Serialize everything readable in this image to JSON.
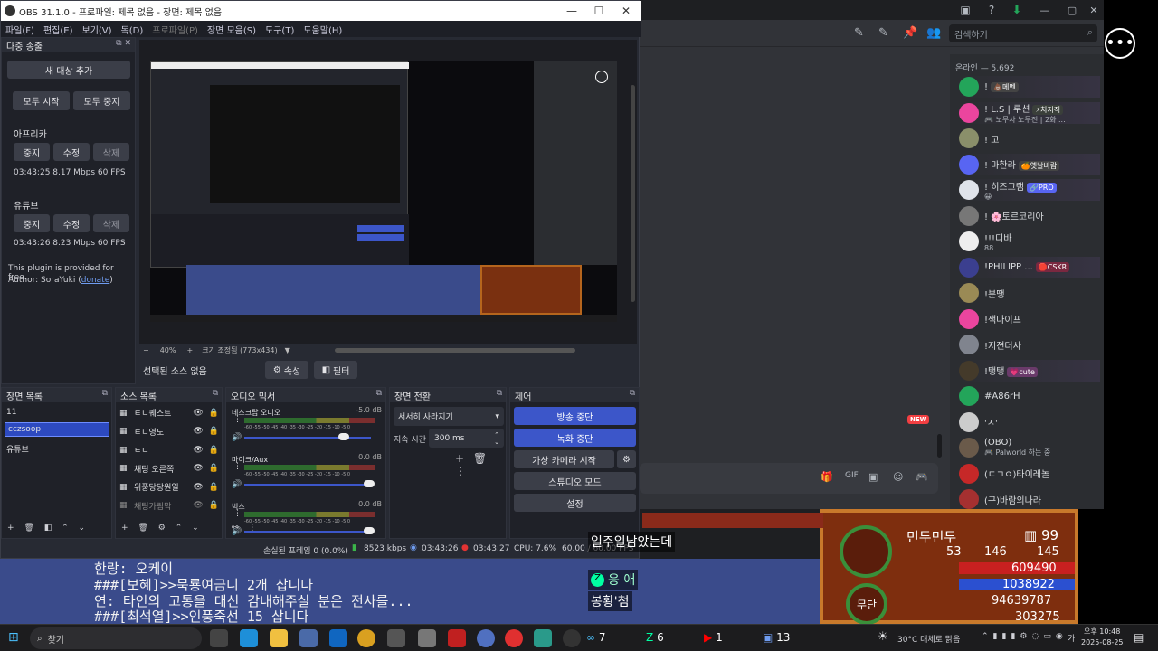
{
  "obs": {
    "title": "OBS 31.1.0 - 프로파일: 제목 없음 - 장면: 제목 없음",
    "menu": [
      "파일(F)",
      "편집(E)",
      "보기(V)",
      "독(D)",
      "프로파일(P)",
      "장면 모음(S)",
      "도구(T)",
      "도움말(H)"
    ],
    "multistream": {
      "title": "다중 송출",
      "add_target": "새 대상 추가",
      "start_all": "모두 시작",
      "stop_all": "모두 중지",
      "targets": [
        {
          "name": "아프리카",
          "stop": "중지",
          "edit": "수정",
          "delete": "삭제",
          "stats": "03:43:25  8.17 Mbps  60 FPS"
        },
        {
          "name": "유튜브",
          "stop": "중지",
          "edit": "수정",
          "delete": "삭제",
          "stats": "03:43:26  8.23 Mbps  60 FPS"
        }
      ],
      "plugin_note": "This plugin is provided for free.",
      "author_prefix": "Author: SoraYuki (",
      "author_link": "donate",
      "author_suffix": ")"
    },
    "zoom": "40%",
    "zoom_mode": "크기 조정됨 (773x434)",
    "no_source": "선택된 소스 없음",
    "properties": "속성",
    "filters": "필터",
    "scenes": {
      "title": "장면 목록",
      "items": [
        "11",
        "cczsoop",
        "유튜브"
      ]
    },
    "sources": {
      "title": "소스 목록",
      "items": [
        "ㅌㄴ퀘스트",
        "ㅌㄴ영도",
        "ㅌㄴ",
        "채팅 오른쪽",
        "위풍당당원일",
        "채팅가림막"
      ]
    },
    "mixer": {
      "title": "오디오 믹서",
      "channels": [
        {
          "name": "데스크탑 오디오",
          "db": "-5.0 dB"
        },
        {
          "name": "마이크/Aux",
          "db": "0.0 dB"
        },
        {
          "name": "빅스",
          "db": "0.0 dB"
        }
      ],
      "scale": "-60 -55 -50 -45 -40 -35 -30 -25 -20 -15 -10 -5 0"
    },
    "transitions": {
      "title": "장면 전환",
      "type": "서서히 사라지기",
      "duration_label": "지속 시간",
      "duration": "300 ms"
    },
    "controls": {
      "title": "제어",
      "stop_stream": "방송 중단",
      "stop_record": "녹화 중단",
      "virtual_cam": "가상 카메라 시작",
      "studio_mode": "스튜디오 모드",
      "settings": "설정"
    },
    "status": {
      "dropped": "손실된 프레임 0 (0.0%)",
      "bitrate": "8523 kbps",
      "stream_time": "03:43:26",
      "rec_time": "03:43:27",
      "cpu": "CPU: 7.6%",
      "fps": "60.00 / 60.00 FPS"
    }
  },
  "discord": {
    "search_placeholder": "검색하기",
    "online_header": "온라인 — 5,692",
    "new_badge": "NEW",
    "members": [
      {
        "name": "!",
        "tag": "💩메멘",
        "tagcolor": "#444",
        "color": "#23a55a",
        "sub": ""
      },
      {
        "name": "! L.S | 루션",
        "tag": "⚡치지직",
        "tagcolor": "#3a3f3a",
        "color": "#eb459e",
        "sub": "🎮 노무사 노무진 | 2화 ..."
      },
      {
        "name": "! 고",
        "tag": "",
        "tagcolor": "",
        "color": "#8a8f6a",
        "sub": ""
      },
      {
        "name": "! 마한라",
        "tag": "🍊옛날바람",
        "tagcolor": "#444",
        "color": "#5865f2",
        "sub": ""
      },
      {
        "name": "! 히즈그램",
        "tag": "🔗PRO",
        "tagcolor": "#5865f2",
        "color": "#dfe3ea",
        "sub": "😀"
      },
      {
        "name": "! 🌸토르코리아",
        "tag": "",
        "tagcolor": "",
        "color": "#777",
        "sub": ""
      },
      {
        "name": "!!!디바",
        "tag": "",
        "tagcolor": "",
        "color": "#eee",
        "sub": "88"
      },
      {
        "name": "!PHILIPP ...",
        "tag": "🛑CSKR",
        "tagcolor": "#7a2840",
        "color": "#3b3f8f",
        "sub": ""
      },
      {
        "name": "!분땡",
        "tag": "",
        "tagcolor": "",
        "color": "#9a8a55",
        "sub": ""
      },
      {
        "name": "!잭나이프",
        "tag": "",
        "tagcolor": "",
        "color": "#eb459e",
        "sub": ""
      },
      {
        "name": "!지젼더사",
        "tag": "",
        "tagcolor": "",
        "color": "#80848e",
        "sub": ""
      },
      {
        "name": "!탱탱",
        "tag": "💗cute",
        "tagcolor": "#6a3a6a",
        "color": "#443a2a",
        "sub": ""
      },
      {
        "name": "#A86rH",
        "tag": "",
        "tagcolor": "",
        "color": "#23a55a",
        "sub": ""
      },
      {
        "name": "'ㅅ'",
        "tag": "",
        "tagcolor": "",
        "color": "#ccc",
        "sub": ""
      },
      {
        "name": "(OBO)",
        "tag": "",
        "tagcolor": "",
        "color": "#6a5a4a",
        "sub": "🎮 Palworld 하는 중"
      },
      {
        "name": "(ㄷㄱㅇ)타이레놀",
        "tag": "",
        "tagcolor": "",
        "color": "#c62828",
        "sub": ""
      },
      {
        "name": "(구)바람의나라",
        "tag": "",
        "tagcolor": "",
        "color": "#a53030",
        "sub": ""
      }
    ]
  },
  "game": {
    "lines": [
      "한랑: 오케이",
      "###[보혜]>>묵룡여금니 2개 삽니다",
      "연: 타인의 고통을 대신 감내해주실 분은 전사를...",
      "###[최석열]>>인풍죽선 15 삽니다"
    ],
    "chat_name": "응 애",
    "chat_msg1": "일주일남았는데",
    "chat_msg2": "봉황'첨",
    "char_name": "민두민두",
    "level": "99",
    "stats": [
      "53",
      "146",
      "145",
      "609490",
      "1038922",
      "94639787",
      "303275"
    ],
    "btn": "무단"
  },
  "taskbar": {
    "search": "찾기",
    "weather": "30°C 대체로 맑음",
    "time": "오후 10:48",
    "date": "2025-08-25",
    "lang": "가",
    "badges": [
      "7",
      "6",
      "1",
      "13"
    ]
  }
}
